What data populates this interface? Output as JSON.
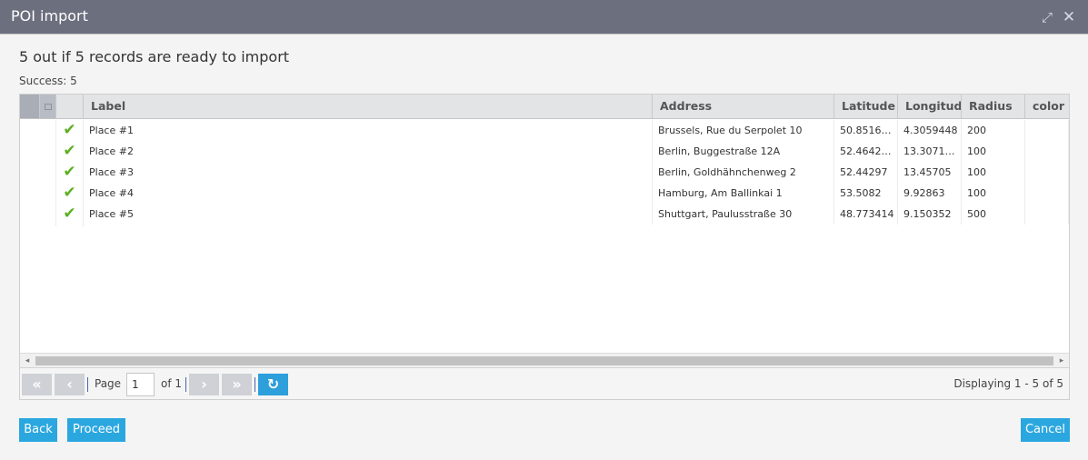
{
  "window": {
    "title": "POI import",
    "maximize_icon": "expand-icon",
    "close_icon": "close-icon"
  },
  "summary": "5 out if 5 records are ready to import",
  "success": "Success: 5",
  "grid": {
    "columns": [
      "Label",
      "Address",
      "Latitude",
      "Longitude",
      "Radius",
      "color"
    ],
    "rows": [
      {
        "status": "check-icon",
        "label": "Place #1",
        "address": "Brussels, Rue du Serpolet 10",
        "latitude": "50.851623...",
        "longitude": "4.3059448",
        "radius": "200",
        "color": ""
      },
      {
        "status": "check-icon",
        "label": "Place #2",
        "address": "Berlin, Buggestraße 12A",
        "latitude": "52.464259...",
        "longitude": "13.307196...",
        "radius": "100",
        "color": ""
      },
      {
        "status": "check-icon",
        "label": "Place #3",
        "address": "Berlin, Goldhähnchenweg 2",
        "latitude": "52.44297",
        "longitude": "13.45705",
        "radius": "100",
        "color": ""
      },
      {
        "status": "check-icon",
        "label": "Place #4",
        "address": "Hamburg, Am Ballinkai 1",
        "latitude": "53.5082",
        "longitude": "9.92863",
        "radius": "100",
        "color": ""
      },
      {
        "status": "check-icon",
        "label": "Place #5",
        "address": "Shuttgart, Paulusstraße 30",
        "latitude": "48.773414",
        "longitude": "9.150352",
        "radius": "500",
        "color": ""
      }
    ]
  },
  "pager": {
    "page_label": "Page",
    "page_value": "1",
    "of_label": "of 1",
    "display": "Displaying 1 - 5 of 5"
  },
  "buttons": {
    "back": "Back",
    "proceed": "Proceed",
    "cancel": "Cancel"
  },
  "colors": {
    "titlebar": "#6b6f7e",
    "accent": "#2ba7e0",
    "success": "#5cb021"
  }
}
